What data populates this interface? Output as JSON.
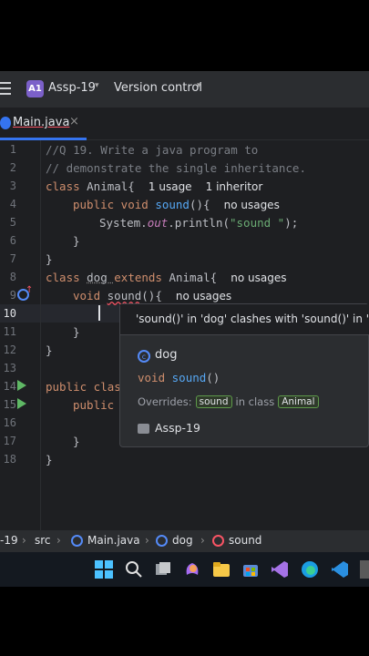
{
  "toolbar": {
    "project_badge": "A1",
    "project_name": "Assp-19",
    "version_control": "Version control"
  },
  "tab": {
    "label": "Main.java",
    "close": "×"
  },
  "editor": {
    "line_numbers": [
      "1",
      "2",
      "3",
      "4",
      "5",
      "6",
      "7",
      "8",
      "9",
      "10",
      "11",
      "12",
      "13",
      "14",
      "15",
      "16",
      "17",
      "18"
    ],
    "lines": {
      "l1": "//Q 19. Write a java program to",
      "l2": "// demonstrate the single inheritance.",
      "l3_kw": "class ",
      "l3_name": "Animal{",
      "l3_hint1": "1 usage",
      "l3_hint2": "1 inheritor",
      "l4_kw": "public void ",
      "l4_fn": "sound",
      "l4_rest": "(){",
      "l4_hint": "no usages",
      "l5_a": "System.",
      "l5_out": "out",
      "l5_b": ".println(",
      "l5_str": "\"sound \"",
      "l5_c": ");",
      "l6": "}",
      "l7": "}",
      "l8_kw": "class ",
      "l8_name": "dog ",
      "l8_kw2": "extends ",
      "l8_rest": "Animal{",
      "l8_hint": "no usages",
      "l9_kw": "void ",
      "l9_fn": "sound",
      "l9_rest": "(){",
      "l9_hint": "no usages",
      "l11": "}",
      "l12": "}",
      "l14_kw": "public clas",
      "l15_kw": "public",
      "l17": "}",
      "l18": "}"
    }
  },
  "popup": {
    "message": "'sound()' in 'dog' clashes with 'sound()' in 'Ani",
    "class_name": "dog",
    "signature": "void sound()",
    "overrides_label": "Overrides:",
    "overrides_method": "sound",
    "in_class_label": "in class",
    "overrides_class": "Animal",
    "module": "Assp-19"
  },
  "breadcrumb": {
    "project": "-19",
    "src": "src",
    "file": "Main.java",
    "class": "dog",
    "method": "sound"
  }
}
